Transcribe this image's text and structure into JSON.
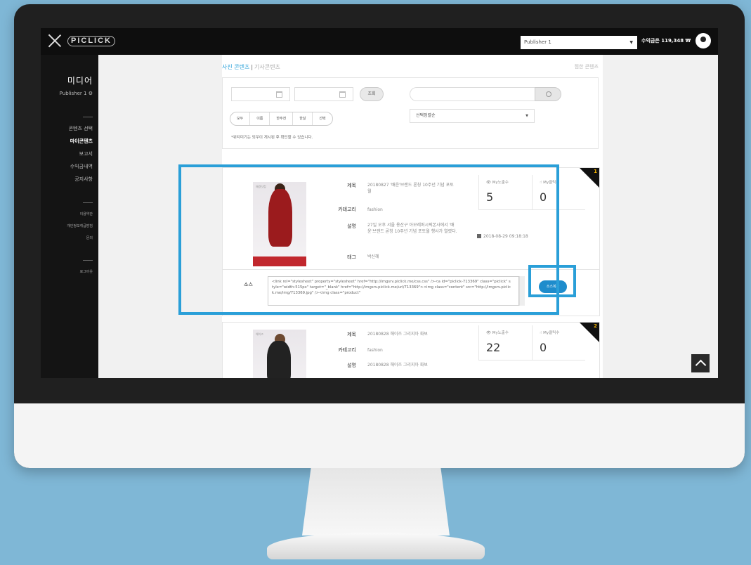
{
  "header": {
    "logo": "PICLICK",
    "publisher_select": "Publisher 1",
    "earnings": "수익금은 119,348 ₩"
  },
  "sidebar": {
    "title": "미디어",
    "publisher": "Publisher 1",
    "items": [
      "콘텐츠 선택",
      "마이콘텐츠",
      "보고서",
      "수익금내역",
      "공지사항"
    ],
    "small_items": [
      "이용약관",
      "개인정보취급방침",
      "문의"
    ],
    "logout": "로그아웃"
  },
  "tabs": {
    "photo": "사진 콘텐츠",
    "article": "기사콘텐츠",
    "right": "찜한 콘텐츠"
  },
  "filter": {
    "query_button": "조회",
    "segments": [
      "모두",
      "이름",
      "한주전",
      "한달",
      "선택"
    ],
    "sort": "선택정렬순",
    "note": "*위티미기는 되우이 게시된 후 확인할 수 있습니다."
  },
  "labels": {
    "title": "제목",
    "category": "카테고리",
    "description": "설명",
    "tag": "태그",
    "source": "소스",
    "views": "My노출수",
    "clicks": "My클릭수",
    "copy": "소스복사"
  },
  "cards": [
    {
      "rank": "1",
      "title": "20180827 '배윤'브랜드 론칭 10주년 기념 포토월",
      "category": "fashion",
      "description": "27일 오후 서울 용산구 아모레퍼시픽본사에서 '배윤'브랜드 론칭 10주년 기념 포토월 행사가 열렸다.",
      "tag": "박신혜",
      "date": "2018-08-29 09:18:18",
      "views": "5",
      "clicks": "0",
      "source": "<link rel=\"stylesheet\" property=\"stylesheet\" href=\"http://imgsrv.piclick.me/css.css\" /><a id=\"piclick-713369\" class=\"piclick\" style=\"width:515px\" target=\"_blank\" href=\"http://imgsrv.piclick.me/url/713369\"><img class=\"content\" src=\"http://imgsrv.piclick.me/img/713369.jpg\" /><img class=\"product\"",
      "thumb_caption": "매경닷컴"
    },
    {
      "rank": "2",
      "title": "20180828 해이즈 그리지아 화보",
      "category": "fashion",
      "description": "20180828 해이즈 그리지아 화보",
      "views": "22",
      "clicks": "0",
      "thumb_caption": "해이즈"
    }
  ]
}
